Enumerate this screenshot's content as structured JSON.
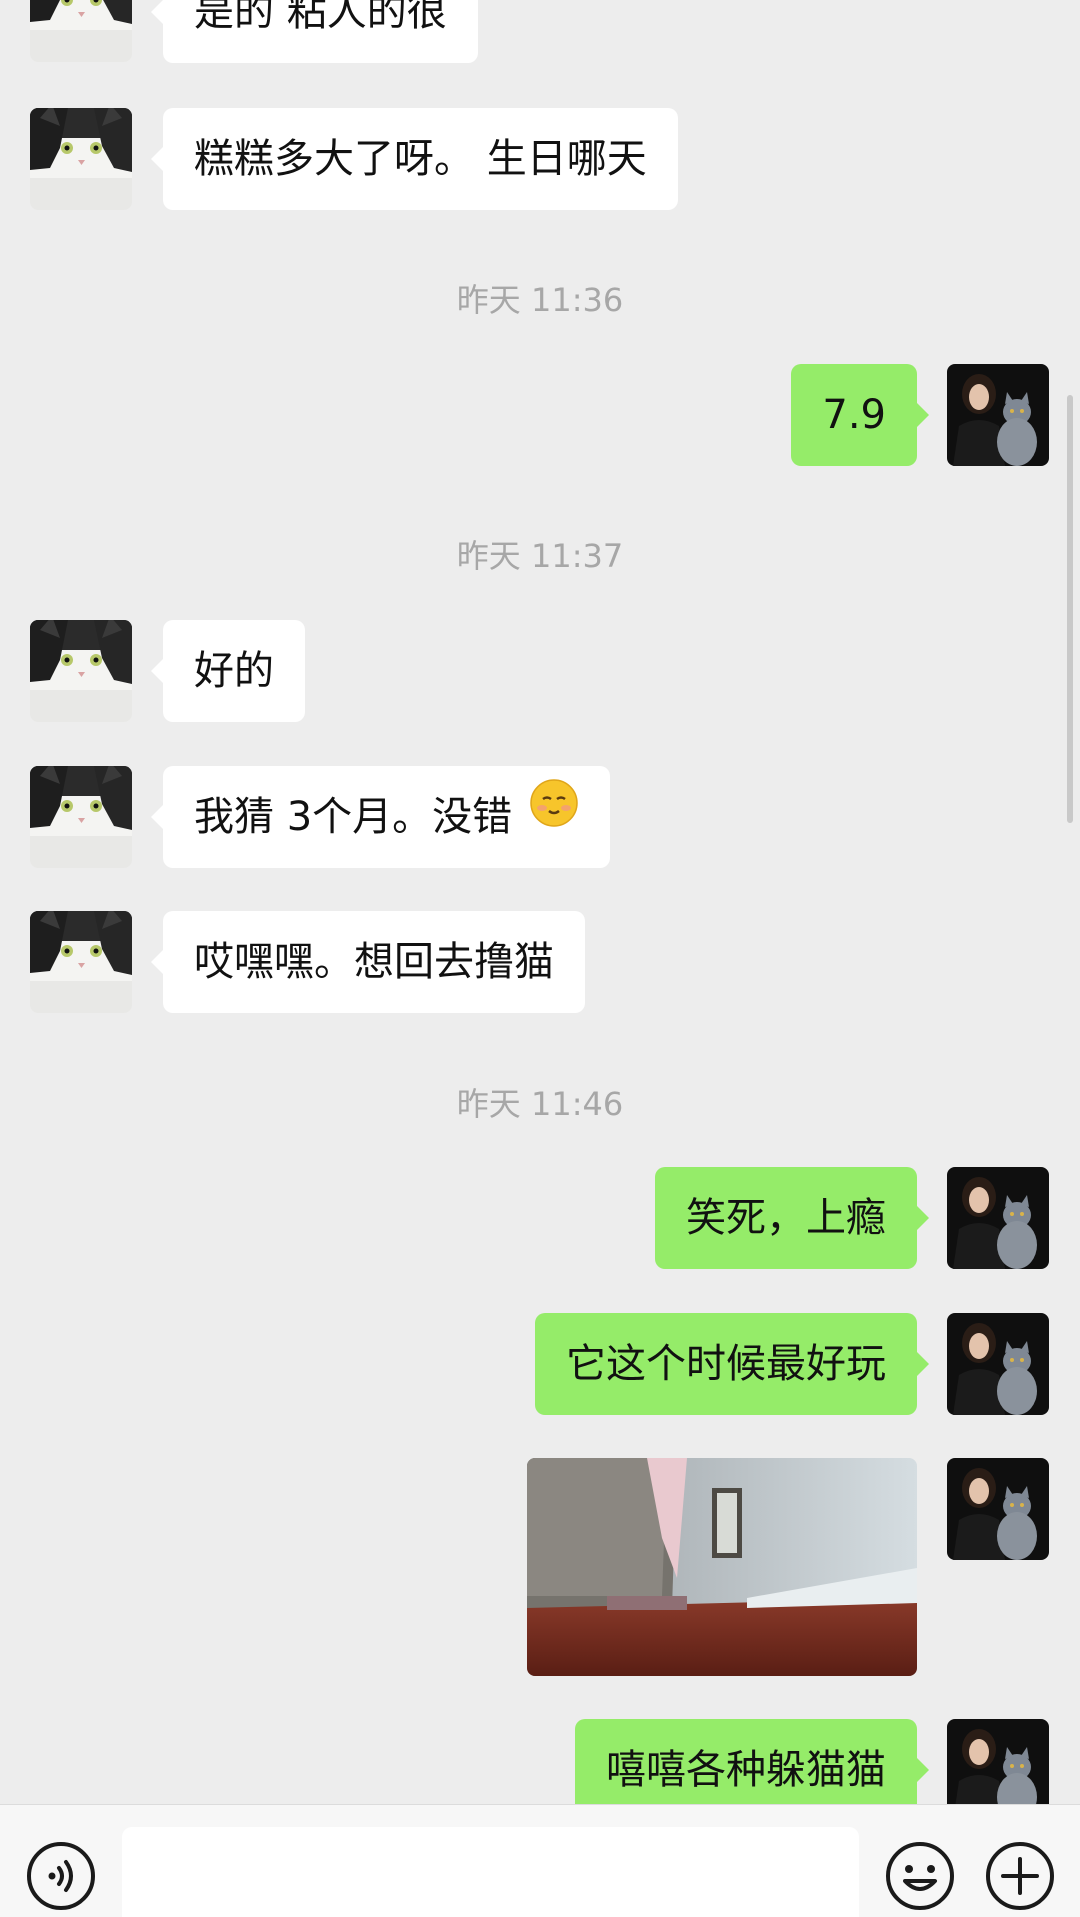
{
  "messages": [
    {
      "text": "是的 粘人的很"
    },
    {
      "text": "糕糕多大了呀。 生日哪天"
    },
    {
      "time": "昨天 11:36"
    },
    {
      "text": "7.9"
    },
    {
      "time": "昨天 11:37"
    },
    {
      "text": "好的"
    },
    {
      "text": "我猜 3个月。没错"
    },
    {
      "text": "哎嘿嘿。想回去撸猫"
    },
    {
      "time": "昨天 11:46"
    },
    {
      "text": "笑死，上瘾"
    },
    {
      "text": "它这个时候最好玩"
    },
    {
      "text": "嘻嘻各种躲猫猫"
    }
  ],
  "emoji": {
    "name": "smiling-face-icon"
  },
  "input_bar": {
    "voice_icon": "voice-icon",
    "emoji_icon": "emoji-icon",
    "add_icon": "plus-icon"
  },
  "colors": {
    "background": "#ededed",
    "outgoing_bubble": "#95ec69",
    "incoming_bubble": "#ffffff",
    "timestamp": "#a7a7a7"
  }
}
